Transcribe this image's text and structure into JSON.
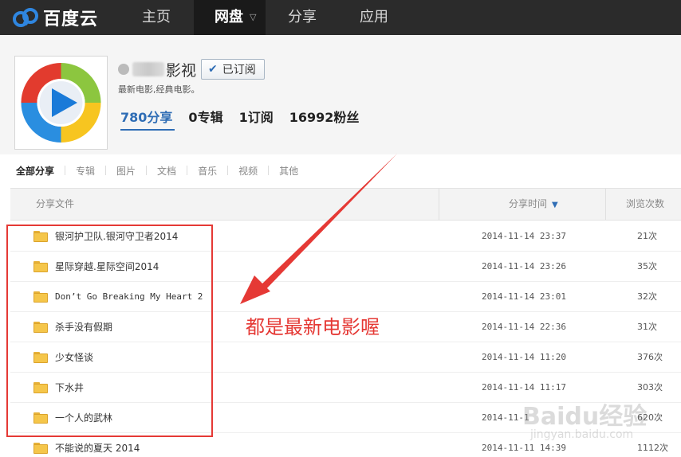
{
  "nav": {
    "logo_text": "百度云",
    "items": [
      {
        "label": "主页",
        "active": false
      },
      {
        "label": "网盘",
        "active": true
      },
      {
        "label": "分享",
        "active": false
      },
      {
        "label": "应用",
        "active": false
      }
    ]
  },
  "profile": {
    "channel_name": "影视",
    "subscribe_label": "已订阅",
    "description": "最新电影,经典电影。",
    "stats": [
      {
        "count": "780",
        "label": "分享",
        "active": true
      },
      {
        "count": "0",
        "label": "专辑",
        "active": false
      },
      {
        "count": "1",
        "label": "订阅",
        "active": false
      },
      {
        "count": "16992",
        "label": "粉丝",
        "active": false
      }
    ]
  },
  "tabs": [
    "全部分享",
    "专辑",
    "图片",
    "文档",
    "音乐",
    "视频",
    "其他"
  ],
  "table": {
    "headers": {
      "file": "分享文件",
      "time": "分享时间",
      "views": "浏览次数"
    },
    "rows": [
      {
        "name": "银河护卫队.银河守卫者2014",
        "time": "2014-11-14 23:37",
        "views": "21次"
      },
      {
        "name": "星际穿越.星际空间2014",
        "time": "2014-11-14 23:26",
        "views": "35次"
      },
      {
        "name": "Don’t Go Breaking My Heart 2",
        "time": "2014-11-14 23:01",
        "views": "32次"
      },
      {
        "name": "杀手没有假期",
        "time": "2014-11-14 22:36",
        "views": "31次"
      },
      {
        "name": "少女怪谈",
        "time": "2014-11-14 11:20",
        "views": "376次"
      },
      {
        "name": "下水井",
        "time": "2014-11-14 11:17",
        "views": "303次"
      },
      {
        "name": "一个人的武林",
        "time": "2014-11-1",
        "views": "620次"
      },
      {
        "name": "不能说的夏天 2014",
        "time": "2014-11-11 14:39",
        "views": "1112次"
      }
    ]
  },
  "annotation": {
    "text": "都是最新电影喔",
    "color": "#e53935"
  },
  "watermark": {
    "main": "Baidu经验",
    "sub": "jingyan.baidu.com"
  },
  "colors": {
    "accent": "#2f6db5",
    "nav_bg": "#2b2b2b",
    "folder": "#f5c64a"
  }
}
